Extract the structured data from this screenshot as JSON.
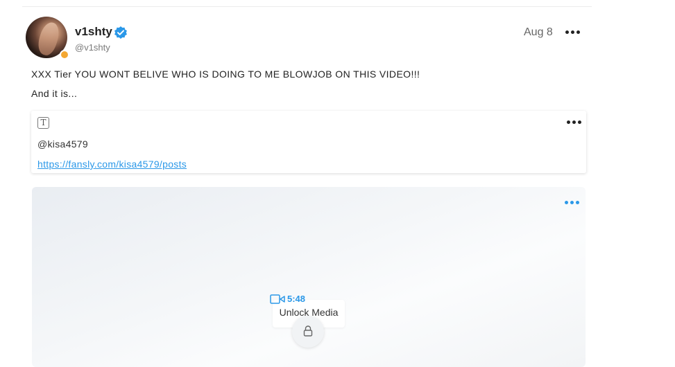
{
  "post": {
    "author": {
      "name": "v1shty",
      "handle": "@v1shty",
      "verified": true,
      "online_status_color": "#f4a833"
    },
    "date": "Aug 8",
    "text_lines": [
      "XXX Tier YOU WONT BELIVE WHO IS DOING TO ME BLOWJOB ON THIS VIDEO!!!",
      "And it is..."
    ]
  },
  "link_card": {
    "icon": "text-format-icon",
    "icon_glyph": "T",
    "mention": "@kisa4579",
    "url": "https://fansly.com/kisa4579/posts"
  },
  "media": {
    "duration": "5:48",
    "unlock_label": "Unlock Media",
    "icons": [
      "video-camera-icon",
      "lock-icon"
    ]
  },
  "colors": {
    "accent": "#2b98e8",
    "text": "#222222",
    "muted": "#7a7a7a"
  }
}
